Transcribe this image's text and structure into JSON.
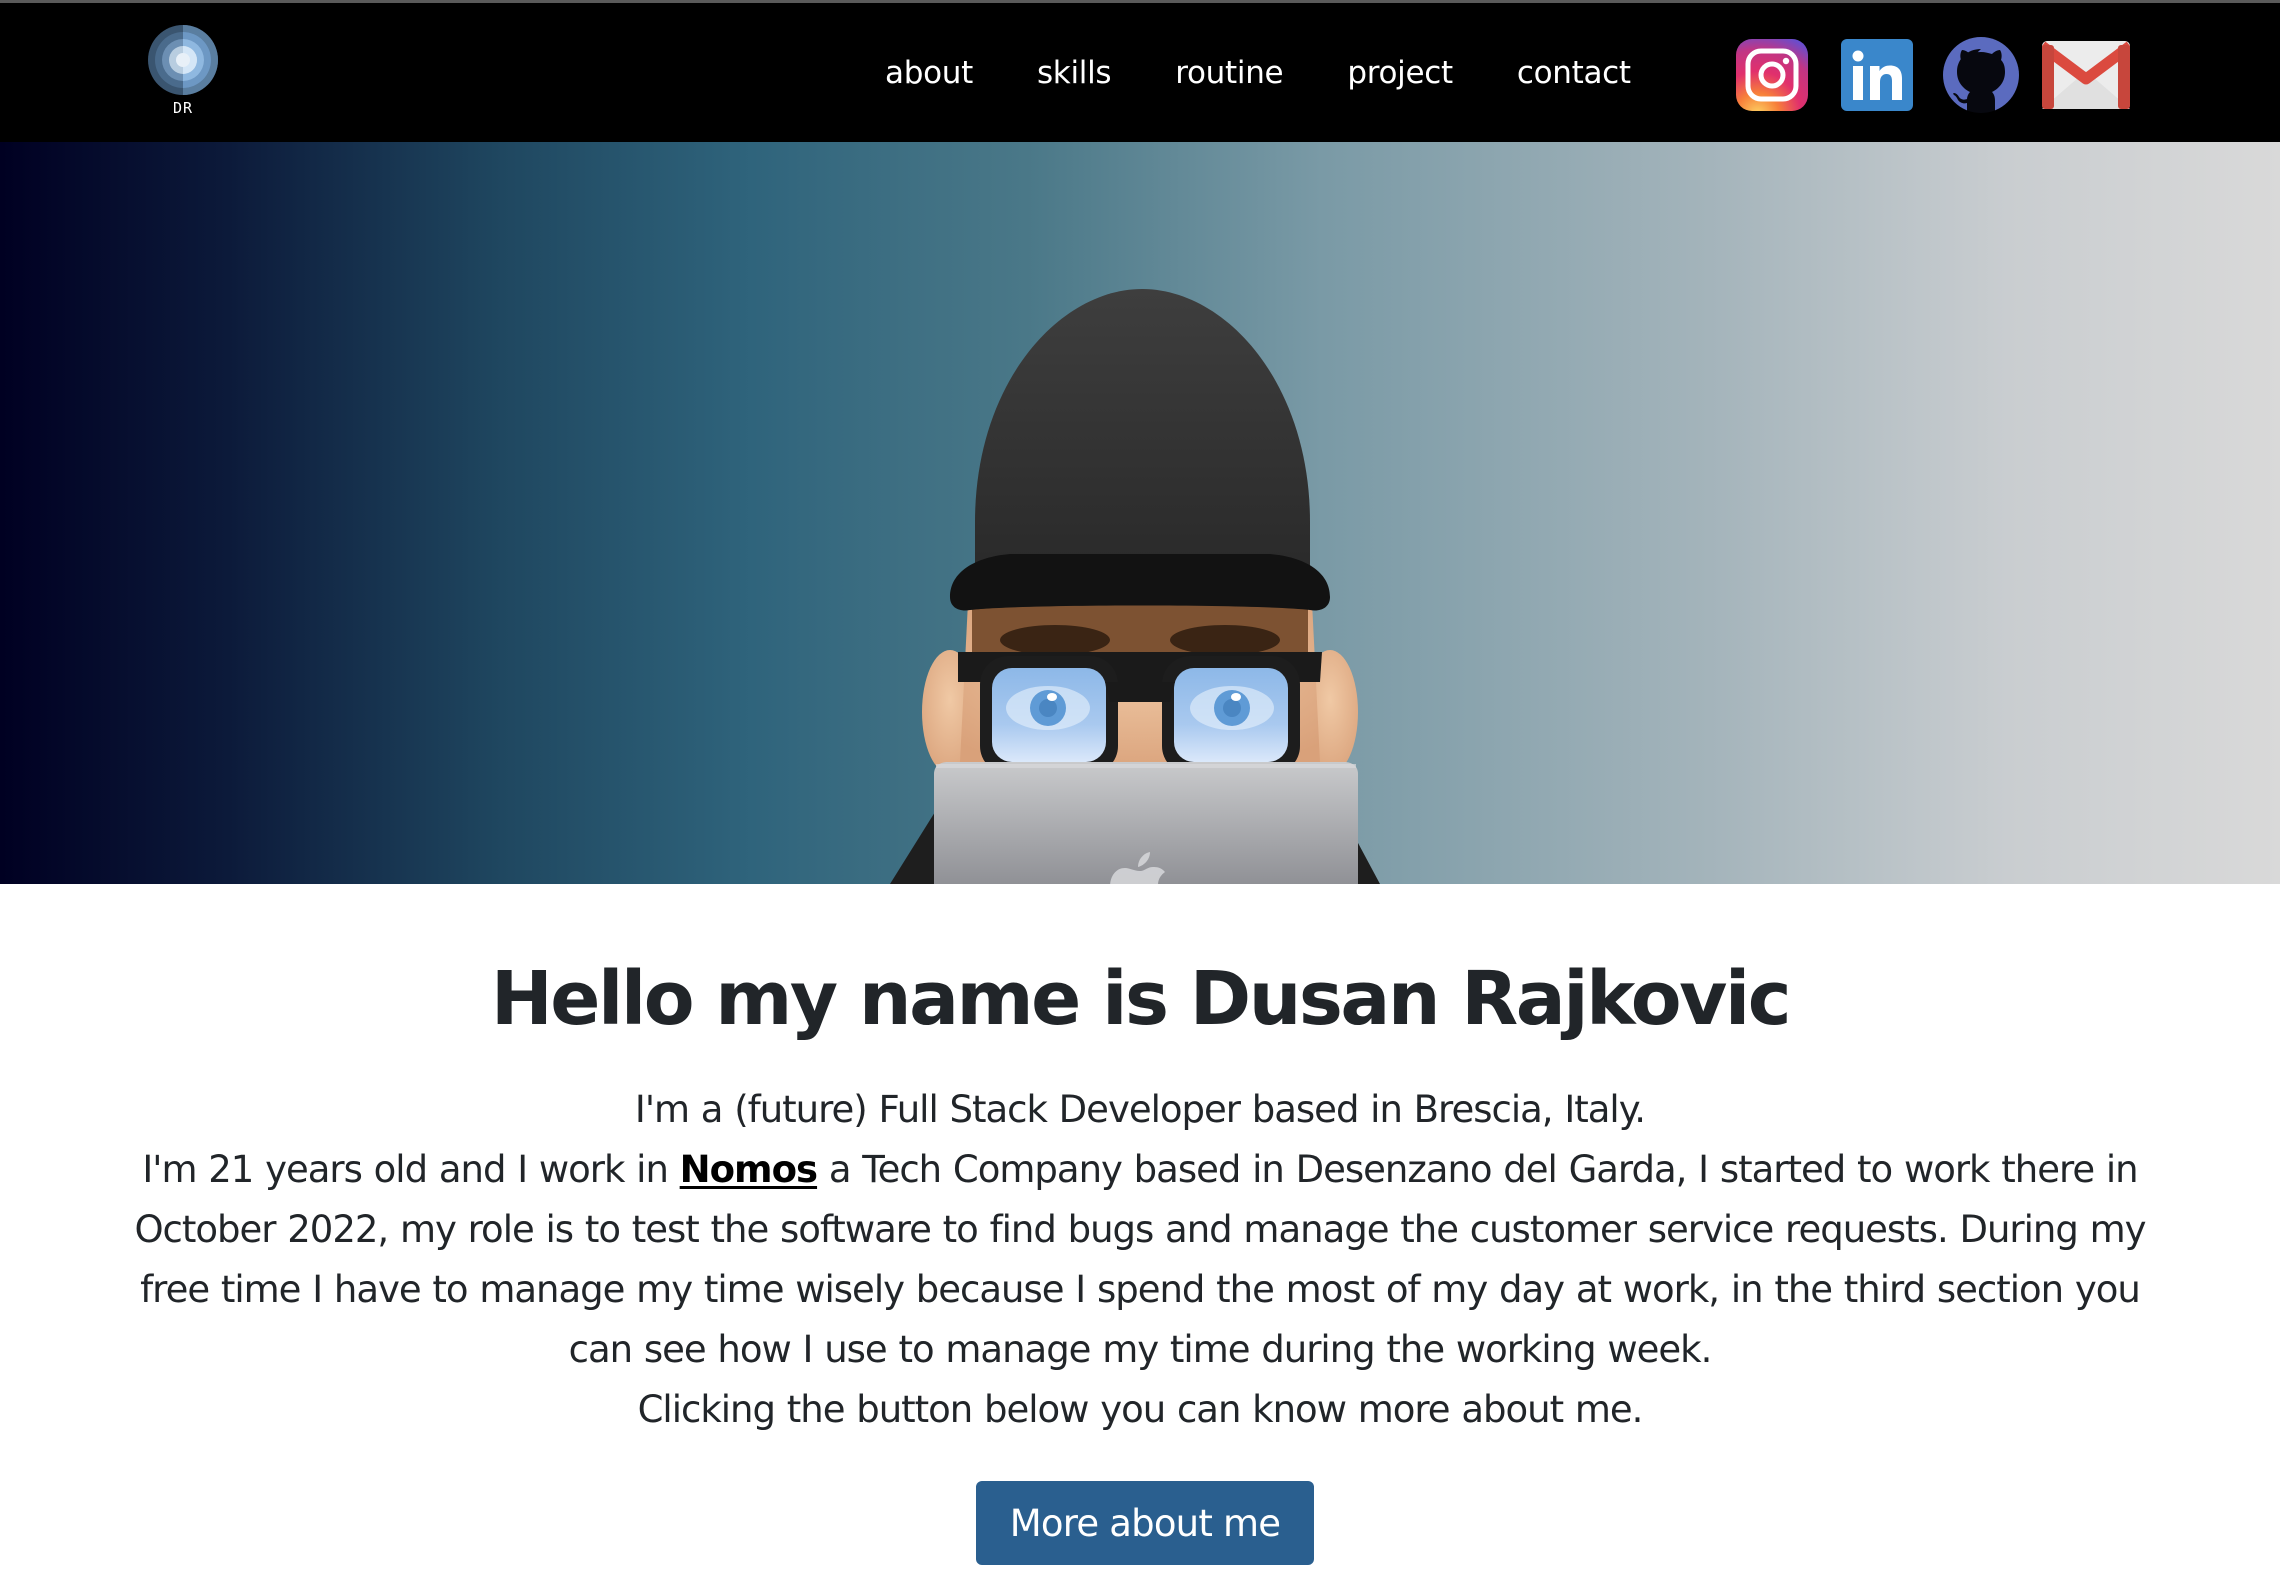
{
  "header": {
    "logo": {
      "text": "DR",
      "icon": "dr-logo-icon"
    },
    "nav": [
      {
        "label": "about"
      },
      {
        "label": "skills"
      },
      {
        "label": "routine"
      },
      {
        "label": "project"
      },
      {
        "label": "contact"
      }
    ],
    "socials": [
      {
        "name": "Instagram",
        "icon": "instagram-icon"
      },
      {
        "name": "LinkedIn",
        "icon": "linkedin-icon",
        "glyph": "in"
      },
      {
        "name": "GitHub",
        "icon": "github-icon"
      },
      {
        "name": "Gmail",
        "icon": "gmail-icon"
      }
    ]
  },
  "hero": {
    "image": "memoji-avatar-with-laptop",
    "gradient_colors": [
      "#000022",
      "#2f647c",
      "#7a9aa6",
      "#d9d9d9"
    ]
  },
  "intro": {
    "title": "Hello my name is Dusan Rajkovic",
    "line1": "I'm a (future) Full Stack Developer based in Brescia, Italy.",
    "line2_before": "I'm 21 years old and I work in ",
    "company": "Nomos",
    "line2_after": " a Tech Company based in Desenzano del Garda, I started to work there in October 2022, my role is to test the software to find bugs and manage the customer service requests. During my free time I have to manage my time wisely because I spend the most of my day at work, in the third section you can see how I use to manage my time during the working week.",
    "line3": "Clicking the button below you can know more about me.",
    "button_label": "More about me"
  },
  "colors": {
    "header_bg": "#000000",
    "button_bg": "#2a5f8f",
    "text": "#212529"
  }
}
